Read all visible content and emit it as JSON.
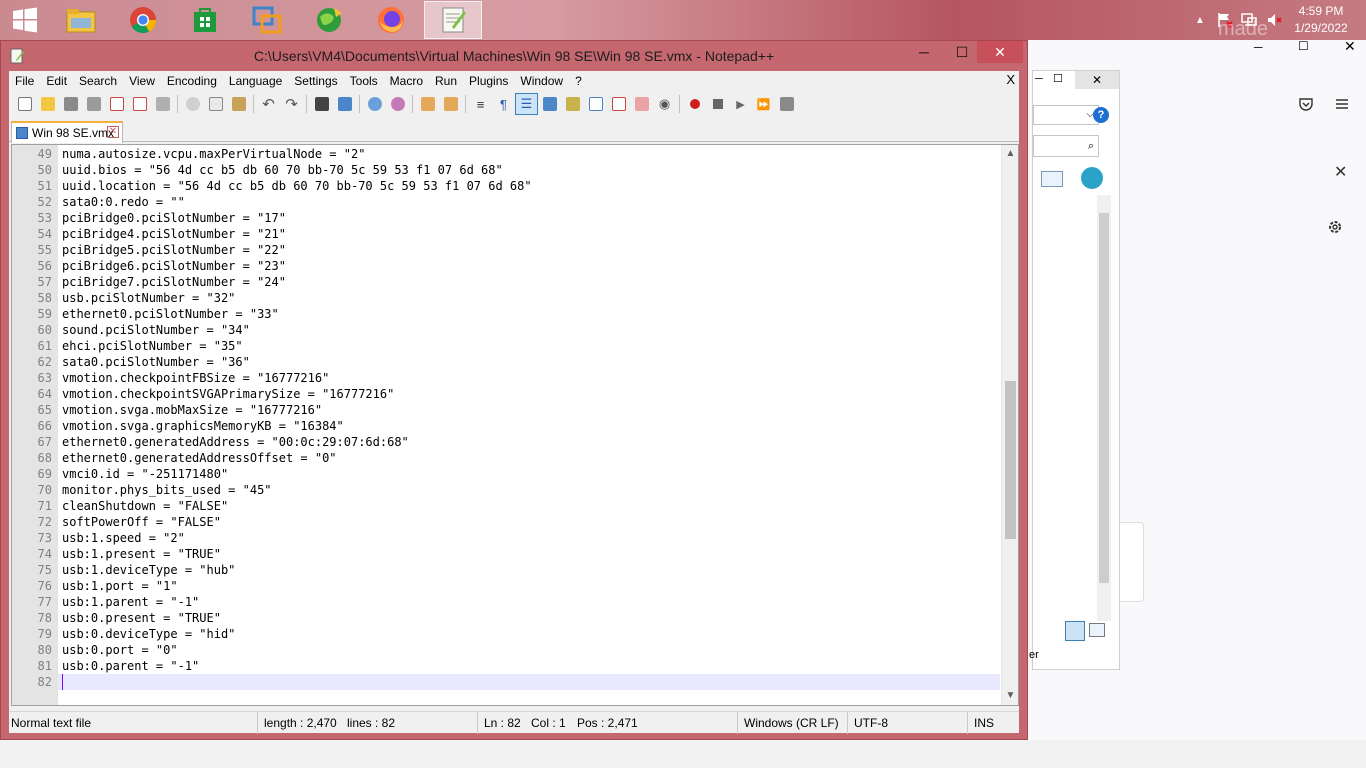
{
  "taskbar": {
    "apps": [
      {
        "icon": "file-explorer-icon",
        "color": "#f4c542"
      },
      {
        "icon": "chrome-icon",
        "color": "#db4437"
      },
      {
        "icon": "store-icon",
        "color": "#1c9a3c"
      },
      {
        "icon": "vmware-icon",
        "color": "#3a86c8"
      },
      {
        "icon": "globe-icon",
        "color": "#2f9c3a"
      },
      {
        "icon": "firefox-icon",
        "color": "#ff7139"
      },
      {
        "icon": "notepadpp-icon",
        "color": "#7cc242"
      }
    ],
    "clock": {
      "time": "4:59 PM",
      "date": "1/29/2022"
    }
  },
  "background_window": {
    "partial_text": "er",
    "partial_title": "made"
  },
  "window": {
    "title": "C:\\Users\\VM4\\Documents\\Virtual Machines\\Win 98 SE\\Win 98 SE.vmx - Notepad++",
    "minimize": "─",
    "maximize": "☐",
    "close": "✕"
  },
  "menu": {
    "items": [
      "File",
      "Edit",
      "Search",
      "View",
      "Encoding",
      "Language",
      "Settings",
      "Tools",
      "Macro",
      "Run",
      "Plugins",
      "Window",
      "?"
    ],
    "close": "X"
  },
  "tab": {
    "label": "Win 98 SE.vmx"
  },
  "editor": {
    "lines": [
      {
        "n": "49",
        "text": "numa.autosize.vcpu.maxPerVirtualNode = \"2\""
      },
      {
        "n": "50",
        "text": "uuid.bios = \"56 4d cc b5 db 60 70 bb-70 5c 59 53 f1 07 6d 68\""
      },
      {
        "n": "51",
        "text": "uuid.location = \"56 4d cc b5 db 60 70 bb-70 5c 59 53 f1 07 6d 68\""
      },
      {
        "n": "52",
        "text": "sata0:0.redo = \"\""
      },
      {
        "n": "53",
        "text": "pciBridge0.pciSlotNumber = \"17\""
      },
      {
        "n": "54",
        "text": "pciBridge4.pciSlotNumber = \"21\""
      },
      {
        "n": "55",
        "text": "pciBridge5.pciSlotNumber = \"22\""
      },
      {
        "n": "56",
        "text": "pciBridge6.pciSlotNumber = \"23\""
      },
      {
        "n": "57",
        "text": "pciBridge7.pciSlotNumber = \"24\""
      },
      {
        "n": "58",
        "text": "usb.pciSlotNumber = \"32\""
      },
      {
        "n": "59",
        "text": "ethernet0.pciSlotNumber = \"33\""
      },
      {
        "n": "60",
        "text": "sound.pciSlotNumber = \"34\""
      },
      {
        "n": "61",
        "text": "ehci.pciSlotNumber = \"35\""
      },
      {
        "n": "62",
        "text": "sata0.pciSlotNumber = \"36\""
      },
      {
        "n": "63",
        "text": "vmotion.checkpointFBSize = \"16777216\""
      },
      {
        "n": "64",
        "text": "vmotion.checkpointSVGAPrimarySize = \"16777216\""
      },
      {
        "n": "65",
        "text": "vmotion.svga.mobMaxSize = \"16777216\""
      },
      {
        "n": "66",
        "text": "vmotion.svga.graphicsMemoryKB = \"16384\""
      },
      {
        "n": "67",
        "text": "ethernet0.generatedAddress = \"00:0c:29:07:6d:68\""
      },
      {
        "n": "68",
        "text": "ethernet0.generatedAddressOffset = \"0\""
      },
      {
        "n": "69",
        "text": "vmci0.id = \"-251171480\""
      },
      {
        "n": "70",
        "text": "monitor.phys_bits_used = \"45\""
      },
      {
        "n": "71",
        "text": "cleanShutdown = \"FALSE\""
      },
      {
        "n": "72",
        "text": "softPowerOff = \"FALSE\""
      },
      {
        "n": "73",
        "text": "usb:1.speed = \"2\""
      },
      {
        "n": "74",
        "text": "usb:1.present = \"TRUE\""
      },
      {
        "n": "75",
        "text": "usb:1.deviceType = \"hub\""
      },
      {
        "n": "76",
        "text": "usb:1.port = \"1\""
      },
      {
        "n": "77",
        "text": "usb:1.parent = \"-1\""
      },
      {
        "n": "78",
        "text": "usb:0.present = \"TRUE\""
      },
      {
        "n": "79",
        "text": "usb:0.deviceType = \"hid\""
      },
      {
        "n": "80",
        "text": "usb:0.port = \"0\""
      },
      {
        "n": "81",
        "text": "usb:0.parent = \"-1\""
      },
      {
        "n": "82",
        "text": ""
      }
    ]
  },
  "status": {
    "file_type": "Normal text file",
    "length": "length : 2,470",
    "lines": "lines : 82",
    "ln": "Ln : 82",
    "col": "Col : 1",
    "pos": "Pos : 2,471",
    "eol": "Windows (CR LF)",
    "encoding": "UTF-8",
    "mode": "INS"
  },
  "colors": {
    "accent": "#c5676f",
    "tab_highlight": "#f5b13a",
    "caret": "#8000ff"
  }
}
